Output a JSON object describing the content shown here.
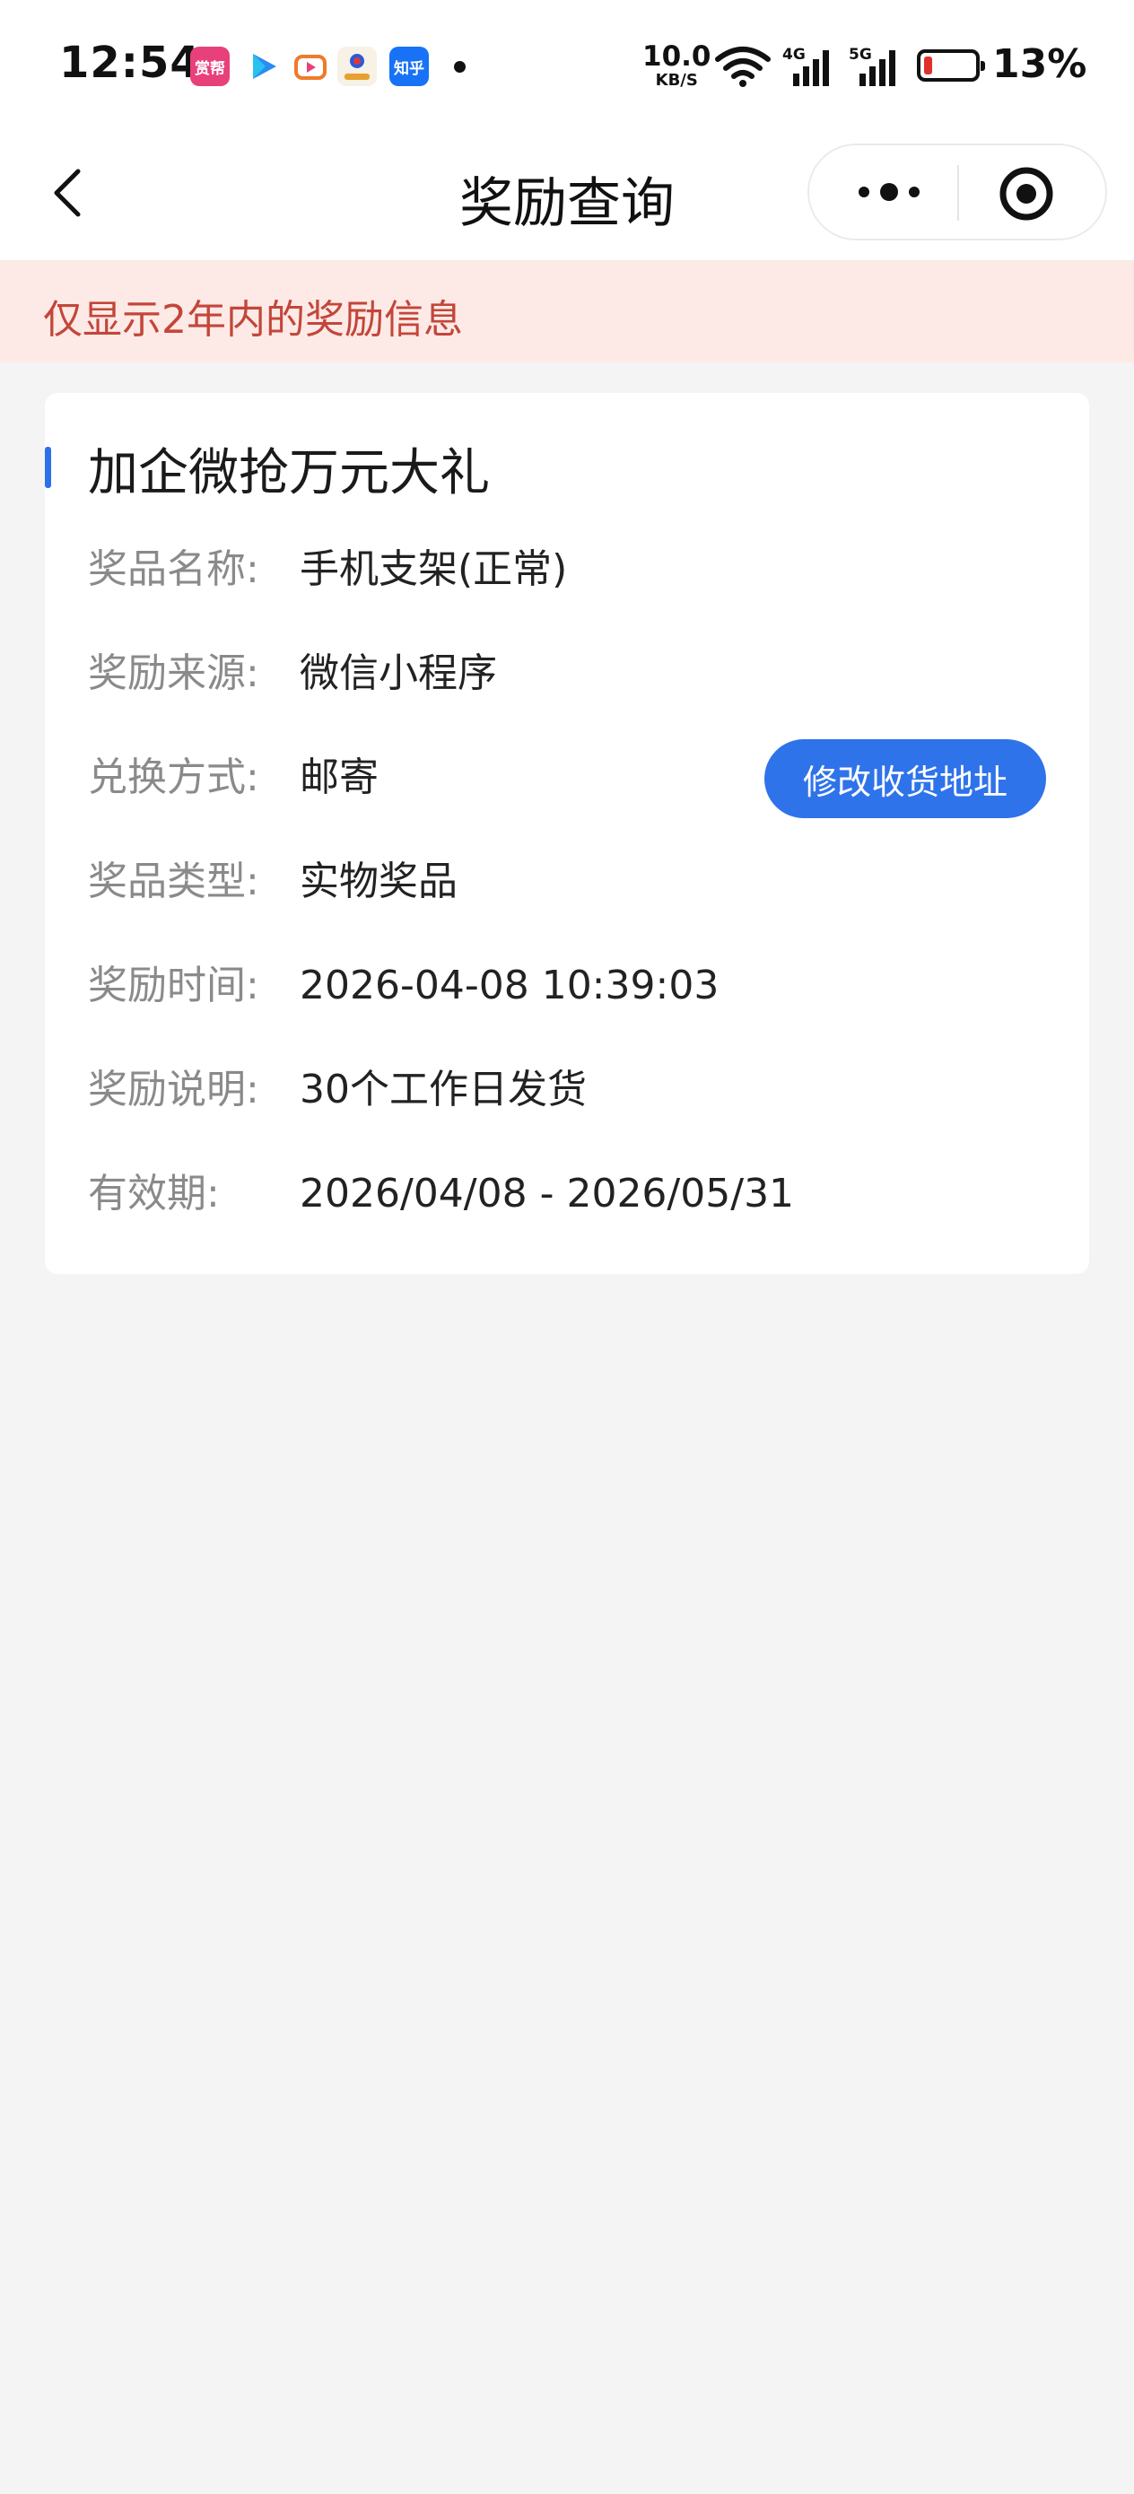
{
  "status_bar": {
    "time": "12:54",
    "app_icons": [
      {
        "name": "shangbang-app-icon",
        "label": "赏帮",
        "color": "#e8407a"
      },
      {
        "name": "play-app-icon",
        "label": "",
        "color": "#2a8cf0"
      },
      {
        "name": "video-app-icon",
        "label": "",
        "color": "#f07a2a"
      },
      {
        "name": "bank-app-icon",
        "label": "",
        "color": "#d83a3a"
      },
      {
        "name": "zhihu-app-icon",
        "label": "知乎",
        "color": "#1772f6"
      }
    ],
    "net_speed": "10.0",
    "net_speed_unit": "KB/S",
    "signal_1_label": "4G",
    "signal_2_label": "5G",
    "battery_percent": "13%"
  },
  "header": {
    "title": "奖励查询"
  },
  "notice": {
    "text": "仅显示2年内的奖励信息"
  },
  "reward_card": {
    "title": "加企微抢万元大礼",
    "rows": [
      {
        "label": "奖品名称:",
        "value": "手机支架(正常)"
      },
      {
        "label": "奖励来源:",
        "value": "微信小程序"
      },
      {
        "label": "兑换方式:",
        "value": "邮寄"
      },
      {
        "label": "奖品类型:",
        "value": "实物奖品"
      },
      {
        "label": "奖励时间:",
        "value": "2026-04-08 10:39:03"
      },
      {
        "label": "奖励说明:",
        "value": "30个工作日发货"
      },
      {
        "label": "有效期:",
        "value": "2026/04/08 - 2026/05/31"
      }
    ],
    "modify_address_button": "修改收货地址"
  },
  "colors": {
    "accent": "#2f73ea",
    "notice_bg": "#fdeae6",
    "notice_text": "#c3463a",
    "page_bg": "#f4f4f4"
  }
}
